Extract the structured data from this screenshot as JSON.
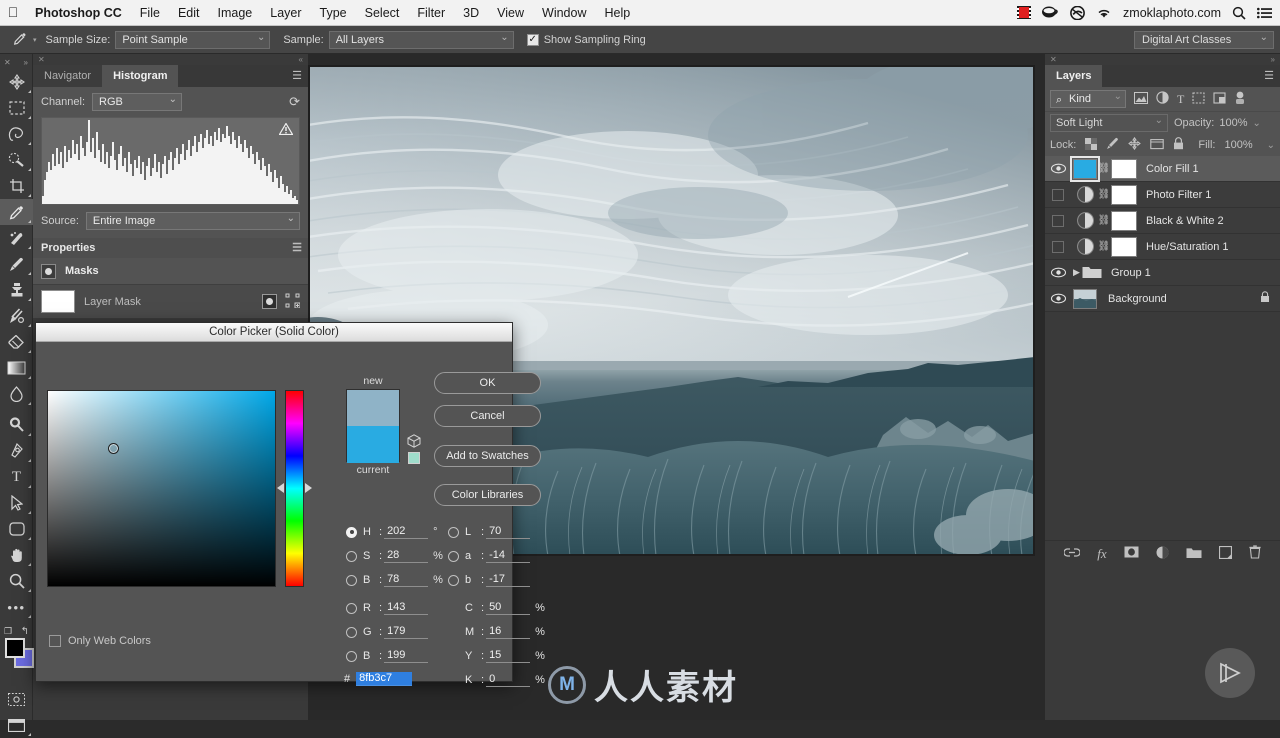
{
  "menubar": {
    "apple_icon": "apple-icon",
    "items": [
      {
        "label": "Photoshop CC",
        "bold": true
      },
      {
        "label": "File",
        "bold": false
      },
      {
        "label": "Edit",
        "bold": false
      },
      {
        "label": "Image",
        "bold": false
      },
      {
        "label": "Layer",
        "bold": false
      },
      {
        "label": "Type",
        "bold": false
      },
      {
        "label": "Select",
        "bold": false
      },
      {
        "label": "Filter",
        "bold": false
      },
      {
        "label": "3D",
        "bold": false
      },
      {
        "label": "View",
        "bold": false
      },
      {
        "label": "Window",
        "bold": false
      },
      {
        "label": "Help",
        "bold": false
      }
    ],
    "status_items": [
      {
        "name": "film-strip-icon",
        "glyph": "▤"
      },
      {
        "name": "coffee-cup-icon",
        "glyph": "☕"
      },
      {
        "name": "creative-cloud-icon",
        "glyph": "◍"
      },
      {
        "name": "wifi-icon",
        "glyph": "◗"
      }
    ],
    "account": "zmoklaphoto.com",
    "search_icon": "search-icon",
    "list_icon": "list-icon"
  },
  "options_bar": {
    "tool_icon": "eyedropper-icon",
    "sample_size_label": "Sample Size:",
    "sample_size_value": "Point Sample",
    "sample_label": "Sample:",
    "sample_value": "All Layers",
    "show_sampling_ring_label": "Show Sampling Ring",
    "show_sampling_ring_checked": true,
    "workspace": "Digital Art Classes"
  },
  "toolbar": {
    "tools": [
      {
        "name": "move-tool",
        "glyph": "✥",
        "active": false,
        "corner": true
      },
      {
        "name": "rectangular-marquee-tool",
        "glyph": "▢",
        "active": false,
        "corner": true
      },
      {
        "name": "lasso-tool",
        "glyph": "✦",
        "active": false,
        "corner": true
      },
      {
        "name": "quick-selection-tool",
        "glyph": "✎",
        "active": false,
        "corner": true
      },
      {
        "name": "crop-tool",
        "glyph": "⌗",
        "active": false,
        "corner": true
      },
      {
        "name": "eyedropper-tool",
        "glyph": "⌯",
        "active": true,
        "corner": true
      },
      {
        "name": "spot-healing-brush-tool",
        "glyph": "✜",
        "active": false,
        "corner": true
      },
      {
        "name": "brush-tool",
        "glyph": "✒",
        "active": false,
        "corner": true
      },
      {
        "name": "clone-stamp-tool",
        "glyph": "⎈",
        "active": false,
        "corner": true
      },
      {
        "name": "history-brush-tool",
        "glyph": "✧",
        "active": false,
        "corner": true
      },
      {
        "name": "eraser-tool",
        "glyph": "◣",
        "active": false,
        "corner": true
      },
      {
        "name": "gradient-tool",
        "glyph": "▬",
        "active": false,
        "corner": true
      },
      {
        "name": "blur-tool",
        "glyph": "◌",
        "active": false,
        "corner": true
      },
      {
        "name": "dodge-tool",
        "glyph": "⚲",
        "active": false,
        "corner": true
      },
      {
        "name": "pen-tool",
        "glyph": "✐",
        "active": false,
        "corner": true
      },
      {
        "name": "type-tool",
        "glyph": "T",
        "active": false,
        "corner": true
      },
      {
        "name": "path-selection-tool",
        "glyph": "➤",
        "active": false,
        "corner": true
      },
      {
        "name": "rounded-rectangle-tool",
        "glyph": "▢",
        "active": false,
        "corner": true
      },
      {
        "name": "hand-tool",
        "glyph": "✋",
        "active": false,
        "corner": true
      },
      {
        "name": "zoom-tool",
        "glyph": "⌕",
        "active": false,
        "corner": true
      },
      {
        "name": "edit-toolbar-tool",
        "glyph": "•••",
        "active": false,
        "corner": true
      }
    ],
    "foreground_color": "#000000",
    "background_color": "#6b6be0",
    "default-colors-icon": "default-colors-icon",
    "swap-colors-icon": "swap-colors-icon",
    "quick-mask-icon": "quick-mask-icon",
    "screen-mode-icon": "screen-mode-icon"
  },
  "left_panel": {
    "tabs": [
      {
        "label": "Navigator",
        "active": false
      },
      {
        "label": "Histogram",
        "active": true
      }
    ],
    "channel_label": "Channel:",
    "channel_value": "RGB",
    "refresh_icon": "refresh-icon",
    "warning_icon": "warning-triangle-icon",
    "source_label": "Source:",
    "source_value": "Entire Image",
    "properties_title": "Properties",
    "masks_label": "Masks",
    "layer_mask_label": "Layer Mask",
    "mask_thumb_icon": "pixel-mask-icon",
    "vector_mask_icon": "vector-mask-icon",
    "panel_menu_icon": "panel-menu-icon"
  },
  "layers_panel": {
    "title": "Layers",
    "panel_menu_icon": "panel-menu-icon",
    "filter_kind": "Kind",
    "filter_search_icon": "search-icon",
    "filter_icons": [
      {
        "name": "filter-pixel-icon",
        "glyph": "▤"
      },
      {
        "name": "filter-adjustment-icon",
        "glyph": "◐"
      },
      {
        "name": "filter-type-icon",
        "glyph": "T"
      },
      {
        "name": "filter-shape-icon",
        "glyph": "▣"
      },
      {
        "name": "filter-smart-object-icon",
        "glyph": "▥"
      },
      {
        "name": "filter-toggle-icon",
        "glyph": "◉"
      }
    ],
    "blend_mode": "Soft Light",
    "opacity_label": "Opacity:",
    "opacity_value": "100%",
    "lock_label": "Lock:",
    "lock_icons": [
      {
        "name": "lock-transparent-pixels-icon",
        "glyph": "▩"
      },
      {
        "name": "lock-image-pixels-icon",
        "glyph": "✏"
      },
      {
        "name": "lock-position-icon",
        "glyph": "✥"
      },
      {
        "name": "lock-artboard-icon",
        "glyph": "▭"
      },
      {
        "name": "lock-all-icon",
        "glyph": "🔒"
      }
    ],
    "fill_label": "Fill:",
    "fill_value": "100%",
    "layers": [
      {
        "name": "Color Fill 1",
        "visible": true,
        "selected": true,
        "type": "fill",
        "has_mask": true,
        "locked": false,
        "thumb_color": "#29abe2"
      },
      {
        "name": "Photo Filter 1",
        "visible": false,
        "selected": false,
        "type": "adjustment",
        "has_mask": true,
        "locked": false,
        "thumb_color": "#cccccc"
      },
      {
        "name": "Black & White 2",
        "visible": false,
        "selected": false,
        "type": "adjustment",
        "has_mask": true,
        "locked": false,
        "thumb_color": "#cccccc"
      },
      {
        "name": "Hue/Saturation 1",
        "visible": false,
        "selected": false,
        "type": "adjustment",
        "has_mask": true,
        "locked": false,
        "thumb_color": "#cccccc"
      },
      {
        "name": "Group 1",
        "visible": true,
        "selected": false,
        "type": "group",
        "has_mask": false,
        "locked": false,
        "thumb_color": "#9a9a9a"
      },
      {
        "name": "Background",
        "visible": true,
        "selected": false,
        "type": "image",
        "has_mask": false,
        "locked": true,
        "thumb_color": "#6f8593"
      }
    ],
    "bottom_icons": [
      {
        "name": "link-layers-icon",
        "glyph": "⛓"
      },
      {
        "name": "layer-style-fx-icon",
        "glyph": "fx"
      },
      {
        "name": "add-layer-mask-icon",
        "glyph": "◉"
      },
      {
        "name": "new-adjustment-layer-icon",
        "glyph": "◐"
      },
      {
        "name": "new-group-icon",
        "glyph": "▰"
      },
      {
        "name": "new-layer-icon",
        "glyph": "▣"
      },
      {
        "name": "delete-layer-icon",
        "glyph": "🗑"
      }
    ]
  },
  "color_picker": {
    "title": "Color Picker (Solid Color)",
    "new_label": "new",
    "current_label": "current",
    "new_color": "#8fb3c7",
    "current_color": "#29abe2",
    "buttons": [
      {
        "label": "OK",
        "name": "ok-button"
      },
      {
        "label": "Cancel",
        "name": "cancel-button"
      },
      {
        "label": "Add to Swatches",
        "name": "add-to-swatches-button"
      },
      {
        "label": "Color Libraries",
        "name": "color-libraries-button"
      }
    ],
    "only_web_colors_label": "Only Web Colors",
    "only_web_colors_checked": false,
    "hsb": [
      {
        "key": "H",
        "value": "202",
        "unit": "°",
        "selected": true
      },
      {
        "key": "S",
        "value": "28",
        "unit": "%",
        "selected": false
      },
      {
        "key": "B",
        "value": "78",
        "unit": "%",
        "selected": false
      }
    ],
    "rgb": [
      {
        "key": "R",
        "value": "143",
        "unit": "",
        "selected": false
      },
      {
        "key": "G",
        "value": "179",
        "unit": "",
        "selected": false
      },
      {
        "key": "B",
        "value": "199",
        "unit": "",
        "selected": false
      }
    ],
    "lab": [
      {
        "key": "L",
        "value": "70",
        "unit": "",
        "selected": false
      },
      {
        "key": "a",
        "value": "-14",
        "unit": "",
        "selected": false
      },
      {
        "key": "b",
        "value": "-17",
        "unit": "",
        "selected": false
      }
    ],
    "cmyk": [
      {
        "key": "C",
        "value": "50",
        "unit": "%"
      },
      {
        "key": "M",
        "value": "16",
        "unit": "%"
      },
      {
        "key": "Y",
        "value": "15",
        "unit": "%"
      },
      {
        "key": "K",
        "value": "0",
        "unit": "%"
      }
    ],
    "hex_symbol": "#",
    "hex_value": "8fb3c7",
    "out_of_gamut_icon": "cube-warning-icon",
    "web_safe_swatch": "#9fdccb"
  },
  "watermark": {
    "text": "人人素材",
    "logo_glyph": "M",
    "play_icon": "play-button-icon"
  }
}
